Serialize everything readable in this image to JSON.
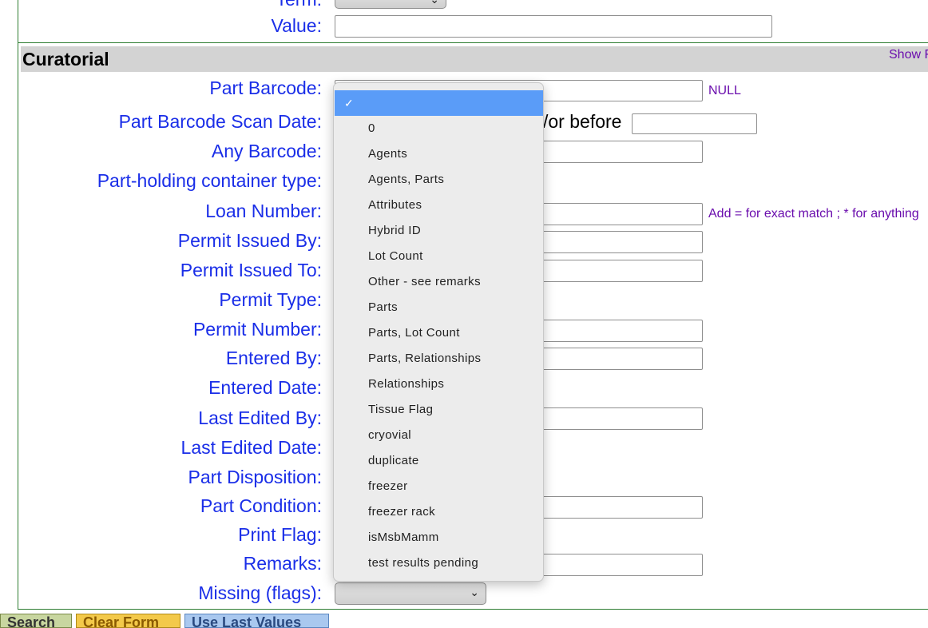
{
  "top": {
    "term_label": "Term:",
    "value_label": "Value:"
  },
  "section": {
    "title": "Curatorial",
    "show_link": "Show F"
  },
  "fields": [
    "Part Barcode:",
    "Part Barcode Scan Date:",
    "Any Barcode:",
    "Part-holding container type:",
    "Loan Number:",
    "Permit Issued By:",
    "Permit Issued To:",
    "Permit Type:",
    "Permit Number:",
    "Entered By:",
    "Entered Date:",
    "Last Edited By:",
    "Last Edited Date:",
    "Part Disposition:",
    "Part Condition:",
    "Print Flag:",
    "Remarks:",
    "Missing (flags):"
  ],
  "notes": {
    "null_label": "NULL",
    "or_before": "/or before",
    "loan_hint": "Add = for exact match ; * for anything"
  },
  "dropdown": {
    "selected_index": 0,
    "options": [
      "",
      "0",
      "Agents",
      "Agents, Parts",
      "Attributes",
      "Hybrid ID",
      "Lot Count",
      "Other - see remarks",
      "Parts",
      "Parts, Lot Count",
      "Parts, Relationships",
      "Relationships",
      "Tissue Flag",
      "cryovial",
      "duplicate",
      "freezer",
      "freezer rack",
      "isMsbMamm",
      "test results pending"
    ]
  },
  "buttons": {
    "search": "Search",
    "clear": "Clear Form",
    "last": "Use Last Values"
  },
  "colors": {
    "label": "#1a2ee8",
    "hint": "#6a0dad",
    "selection": "#5a9cf8",
    "frame": "#2e7d32"
  }
}
